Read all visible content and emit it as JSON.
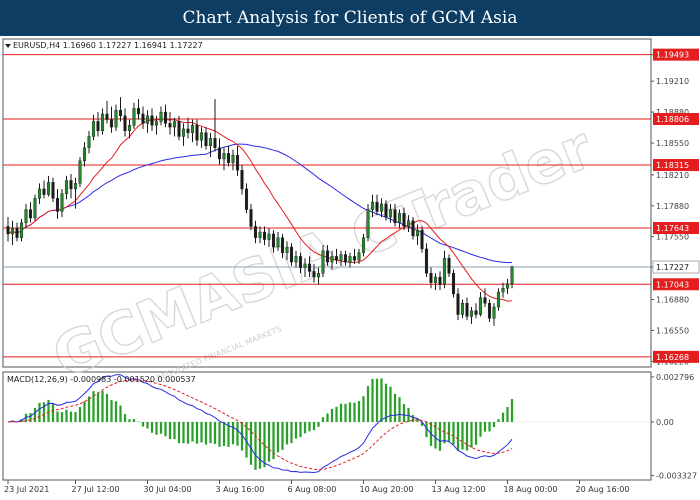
{
  "banner": {
    "title": "Chart Analysis for Clients of GCM Asia"
  },
  "watermark": {
    "text": "GCMASIA CTrader",
    "subtext": "REGULATED FINANCIAL MARKETS"
  },
  "chart_data": [
    {
      "type": "candlestick",
      "symbol_label": "EURUSD,H4",
      "ohlc_label": "1.16960 1.17227 1.16941 1.17227",
      "ylim": [
        1.1616,
        1.1966
      ],
      "y_ticks": [
        "1.19493",
        "1.19210",
        "1.18880",
        "1.18550",
        "1.18210",
        "1.17880",
        "1.17550",
        "1.17227",
        "1.16880",
        "1.16550",
        "1.16220"
      ],
      "y_tick_values": [
        1.19493,
        1.1921,
        1.1888,
        1.1855,
        1.1821,
        1.1788,
        1.1755,
        1.17227,
        1.1688,
        1.1655,
        1.1622
      ],
      "x_ticks": [
        "23 Jul 2021",
        "27 Jul 12:00",
        "30 Jul 04:00",
        "3 Aug 16:00",
        "6 Aug 08:00",
        "10 Aug 20:00",
        "13 Aug 12:00",
        "18 Aug 00:00",
        "20 Aug 16:00"
      ],
      "x_tick_index": [
        0,
        15,
        31,
        47,
        63,
        79,
        95,
        111,
        127
      ],
      "current_price": {
        "value": 1.17227,
        "label": "1.17227",
        "color": "#1a1a1a"
      },
      "levels": [
        {
          "value": 1.19493,
          "label": "1.19493"
        },
        {
          "value": 1.18806,
          "label": "1.18806"
        },
        {
          "value": 1.18315,
          "label": "1.18315"
        },
        {
          "value": 1.17643,
          "label": "1.17643"
        },
        {
          "value": 1.17043,
          "label": "1.17043"
        },
        {
          "value": 1.16268,
          "label": "1.16268"
        }
      ],
      "level_color": "#e41e1e",
      "candle_up_color": "#1f8a2a",
      "candle_down_color": "#1a1a1a",
      "ma_fast_color": "#e41e1e",
      "ma_slow_color": "#2a2ae8",
      "candles": [
        [
          1.1766,
          1.1776,
          1.175,
          1.1758
        ],
        [
          1.1758,
          1.1772,
          1.1746,
          1.1764
        ],
        [
          1.1764,
          1.177,
          1.175,
          1.1754
        ],
        [
          1.1754,
          1.1774,
          1.175,
          1.177
        ],
        [
          1.177,
          1.179,
          1.1764,
          1.1784
        ],
        [
          1.1784,
          1.1792,
          1.177,
          1.1775
        ],
        [
          1.1775,
          1.18,
          1.1772,
          1.1796
        ],
        [
          1.1796,
          1.1812,
          1.179,
          1.1806
        ],
        [
          1.1806,
          1.1815,
          1.1796,
          1.18
        ],
        [
          1.18,
          1.182,
          1.1798,
          1.1813
        ],
        [
          1.1813,
          1.1818,
          1.1792,
          1.1796
        ],
        [
          1.1796,
          1.1806,
          1.1774,
          1.1782
        ],
        [
          1.1782,
          1.1806,
          1.1776,
          1.1801
        ],
        [
          1.1801,
          1.182,
          1.1795,
          1.1815
        ],
        [
          1.1815,
          1.1822,
          1.1796,
          1.1806
        ],
        [
          1.1806,
          1.1818,
          1.1785,
          1.1812
        ],
        [
          1.1812,
          1.184,
          1.1808,
          1.1836
        ],
        [
          1.1836,
          1.1856,
          1.183,
          1.185
        ],
        [
          1.185,
          1.1868,
          1.1844,
          1.1862
        ],
        [
          1.1862,
          1.1885,
          1.1858,
          1.1878
        ],
        [
          1.1878,
          1.1888,
          1.1862,
          1.1868
        ],
        [
          1.1868,
          1.1892,
          1.1864,
          1.1886
        ],
        [
          1.1886,
          1.19,
          1.1876,
          1.188
        ],
        [
          1.188,
          1.1894,
          1.1866,
          1.1872
        ],
        [
          1.1872,
          1.1896,
          1.1868,
          1.189
        ],
        [
          1.189,
          1.1904,
          1.1878,
          1.1884
        ],
        [
          1.1884,
          1.1892,
          1.1862,
          1.1868
        ],
        [
          1.1868,
          1.188,
          1.186,
          1.1874
        ],
        [
          1.1874,
          1.1898,
          1.187,
          1.1892
        ],
        [
          1.1892,
          1.1902,
          1.188,
          1.1886
        ],
        [
          1.1886,
          1.1894,
          1.187,
          1.1876
        ],
        [
          1.1876,
          1.189,
          1.1866,
          1.1884
        ],
        [
          1.1884,
          1.1892,
          1.1868,
          1.1874
        ],
        [
          1.1874,
          1.1884,
          1.1864,
          1.1878
        ],
        [
          1.1878,
          1.1894,
          1.1874,
          1.1888
        ],
        [
          1.1888,
          1.1896,
          1.1872,
          1.1876
        ],
        [
          1.1876,
          1.1888,
          1.1864,
          1.1872
        ],
        [
          1.1872,
          1.1882,
          1.1862,
          1.1878
        ],
        [
          1.1878,
          1.1884,
          1.1858,
          1.1862
        ],
        [
          1.1862,
          1.1876,
          1.1852,
          1.187
        ],
        [
          1.187,
          1.1882,
          1.186,
          1.1866
        ],
        [
          1.1866,
          1.188,
          1.1856,
          1.1874
        ],
        [
          1.1874,
          1.188,
          1.1852,
          1.1858
        ],
        [
          1.1858,
          1.1872,
          1.185,
          1.1866
        ],
        [
          1.1866,
          1.1872,
          1.1848,
          1.1852
        ],
        [
          1.1852,
          1.1866,
          1.184,
          1.186
        ],
        [
          1.186,
          1.1902,
          1.1846,
          1.185
        ],
        [
          1.185,
          1.186,
          1.1832,
          1.1838
        ],
        [
          1.1838,
          1.185,
          1.1826,
          1.1844
        ],
        [
          1.1844,
          1.1852,
          1.183,
          1.1834
        ],
        [
          1.1834,
          1.1848,
          1.1826,
          1.1842
        ],
        [
          1.1842,
          1.1852,
          1.182,
          1.1826
        ],
        [
          1.1826,
          1.1832,
          1.18,
          1.1806
        ],
        [
          1.1806,
          1.1812,
          1.178,
          1.1784
        ],
        [
          1.1784,
          1.179,
          1.1762,
          1.1766
        ],
        [
          1.1766,
          1.1772,
          1.1748,
          1.1754
        ],
        [
          1.1754,
          1.1766,
          1.1748,
          1.176
        ],
        [
          1.176,
          1.1766,
          1.1746,
          1.1752
        ],
        [
          1.1752,
          1.1764,
          1.1744,
          1.1758
        ],
        [
          1.1758,
          1.1762,
          1.1738,
          1.1744
        ],
        [
          1.1744,
          1.176,
          1.174,
          1.1754
        ],
        [
          1.1754,
          1.1758,
          1.1732,
          1.1738
        ],
        [
          1.1738,
          1.175,
          1.173,
          1.1744
        ],
        [
          1.1744,
          1.1748,
          1.1724,
          1.1728
        ],
        [
          1.1728,
          1.174,
          1.1722,
          1.1734
        ],
        [
          1.1734,
          1.1738,
          1.1716,
          1.1722
        ],
        [
          1.1722,
          1.1732,
          1.1712,
          1.1726
        ],
        [
          1.1726,
          1.1734,
          1.1712,
          1.1718
        ],
        [
          1.1718,
          1.1726,
          1.1706,
          1.1712
        ],
        [
          1.1712,
          1.1722,
          1.1704,
          1.1716
        ],
        [
          1.1716,
          1.1746,
          1.1712,
          1.174
        ],
        [
          1.174,
          1.1746,
          1.1724,
          1.1728
        ],
        [
          1.1728,
          1.174,
          1.172,
          1.1734
        ],
        [
          1.1734,
          1.1742,
          1.1726,
          1.173
        ],
        [
          1.173,
          1.174,
          1.1724,
          1.1736
        ],
        [
          1.1736,
          1.174,
          1.1724,
          1.1728
        ],
        [
          1.1728,
          1.1738,
          1.1722,
          1.1734
        ],
        [
          1.1734,
          1.1742,
          1.1726,
          1.173
        ],
        [
          1.173,
          1.1742,
          1.1726,
          1.1738
        ],
        [
          1.1738,
          1.1758,
          1.1734,
          1.1754
        ],
        [
          1.1754,
          1.179,
          1.175,
          1.1784
        ],
        [
          1.1784,
          1.18,
          1.1776,
          1.1792
        ],
        [
          1.1792,
          1.18,
          1.1778,
          1.1782
        ],
        [
          1.1782,
          1.1796,
          1.1776,
          1.179
        ],
        [
          1.179,
          1.1794,
          1.1772,
          1.1776
        ],
        [
          1.1776,
          1.179,
          1.177,
          1.1784
        ],
        [
          1.1784,
          1.179,
          1.1766,
          1.177
        ],
        [
          1.177,
          1.1784,
          1.1764,
          1.178
        ],
        [
          1.178,
          1.1786,
          1.1762,
          1.1766
        ],
        [
          1.1766,
          1.1778,
          1.176,
          1.1772
        ],
        [
          1.1772,
          1.1776,
          1.1752,
          1.1756
        ],
        [
          1.1756,
          1.1768,
          1.1746,
          1.1762
        ],
        [
          1.1762,
          1.1766,
          1.1738,
          1.1742
        ],
        [
          1.1742,
          1.1748,
          1.1712,
          1.1716
        ],
        [
          1.1716,
          1.1722,
          1.17,
          1.1706
        ],
        [
          1.1706,
          1.1716,
          1.1698,
          1.1712
        ],
        [
          1.1712,
          1.1718,
          1.1698,
          1.1704
        ],
        [
          1.1704,
          1.174,
          1.17,
          1.1732
        ],
        [
          1.1732,
          1.1736,
          1.1712,
          1.1716
        ],
        [
          1.1716,
          1.172,
          1.169,
          1.1694
        ],
        [
          1.1694,
          1.17,
          1.1666,
          1.1672
        ],
        [
          1.1672,
          1.1688,
          1.1668,
          1.1684
        ],
        [
          1.1684,
          1.169,
          1.1666,
          1.167
        ],
        [
          1.167,
          1.168,
          1.1662,
          1.1676
        ],
        [
          1.1676,
          1.1684,
          1.1668,
          1.1672
        ],
        [
          1.1672,
          1.1696,
          1.167,
          1.169
        ],
        [
          1.169,
          1.17,
          1.168,
          1.1684
        ],
        [
          1.1684,
          1.1688,
          1.1664,
          1.1668
        ],
        [
          1.1668,
          1.1684,
          1.166,
          1.168
        ],
        [
          1.168,
          1.17,
          1.1676,
          1.1696
        ],
        [
          1.1696,
          1.1706,
          1.169,
          1.17
        ],
        [
          1.17,
          1.171,
          1.1694,
          1.1705
        ],
        [
          1.1705,
          1.1724,
          1.17,
          1.1723
        ]
      ]
    },
    {
      "type": "macd",
      "label": "MACD(12,26,9) -0.000983 -0.001520 0.000537",
      "y_ticks": [
        "0.002796",
        "0.00",
        "-0.003327"
      ],
      "y_tick_values": [
        0.002796,
        0.0,
        -0.003327
      ],
      "ylim": [
        -0.0036,
        0.0031
      ],
      "histogram_color": "#2aa02a",
      "macd_color": "#2a2ae8",
      "signal_color": "#e41e1e"
    }
  ]
}
